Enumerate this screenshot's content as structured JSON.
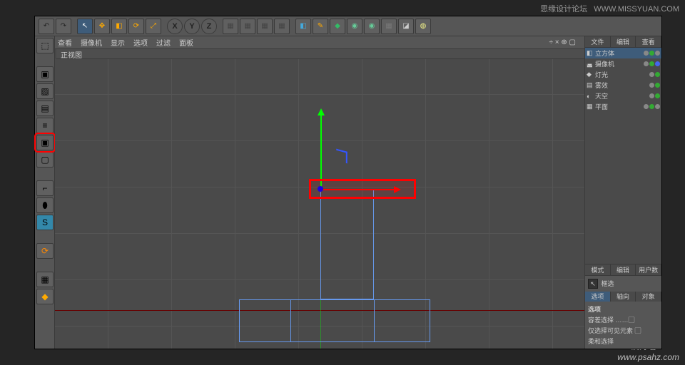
{
  "watermarks": {
    "top_left": "思缘设计论坛",
    "top_right": "WWW.MISSYUAN.COM",
    "bottom_right_1": "PS 爱好者",
    "bottom_right_2": "www.psahz.com"
  },
  "toolbar": {
    "undo": "↶",
    "redo": "↷",
    "select": "↖",
    "move": "✥",
    "rotate": "⟳",
    "scale": "⤢",
    "xyz": [
      "X",
      "Y",
      "Z"
    ],
    "clapper": "▦",
    "anim1": "▦",
    "anim2": "▦",
    "anim3": "▦",
    "cube": "◧",
    "pen": "✎",
    "deform": "◆",
    "env1": "◉",
    "env2": "◉",
    "grid": "▦",
    "cam": "◪",
    "bulb": "◍"
  },
  "left_tools": [
    "⬚",
    "▣",
    "▨",
    "▤",
    "≡",
    "▣",
    "▢",
    "⌐",
    "⬮",
    "S",
    "⟳",
    "▦",
    "◆"
  ],
  "view_menu": [
    "查看",
    "摄像机",
    "显示",
    "选项",
    "过滤",
    "面板"
  ],
  "view_icons": "÷ × ⊕ ▢",
  "view_label": "正视图",
  "objects": {
    "tabs": [
      "文件",
      "编辑",
      "查看"
    ],
    "items": [
      {
        "icon": "◧",
        "name": "立方体",
        "sel": true
      },
      {
        "icon": "◛",
        "name": "摄像机"
      },
      {
        "icon": "◆",
        "name": "灯光"
      },
      {
        "icon": "▤",
        "name": "雾效"
      },
      {
        "icon": "◐",
        "name": "天空"
      },
      {
        "icon": "▦",
        "name": "平面"
      }
    ]
  },
  "attributes": {
    "tabs": [
      "模式",
      "编辑",
      "用户数"
    ],
    "mode_icon": "↖",
    "mode_label": "框选",
    "subtabs": [
      "选项",
      "轴向",
      "对象"
    ],
    "section": "选项",
    "row1": "容差选择 ……▢",
    "row2": "仅选择可见元素 ▢",
    "row3": "柔和选择"
  }
}
